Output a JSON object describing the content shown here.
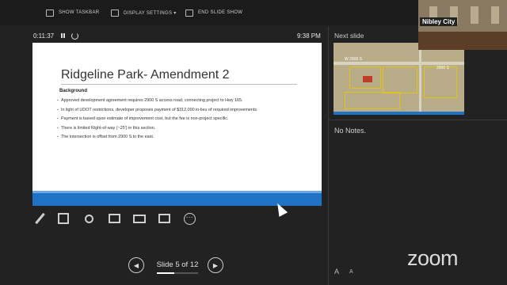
{
  "toolbar": {
    "show_taskbar": "SHOW TASKBAR",
    "display_settings": "DISPLAY SETTINGS ▾",
    "end_slide_show": "END SLIDE SHOW"
  },
  "status": {
    "timer": "0:11:37",
    "clock": "9:38 PM"
  },
  "slide": {
    "title": "Ridgeline Park- Amendment 2",
    "heading": "Background",
    "bullets": [
      "Approved development agreement requires 2900 S access road, connecting project to Hwy 165.",
      "In light of UDOT restrictions, developer proposes payment of $312,000 in-lieu of required improvements.",
      "Payment is based upon estimate of improvement cost, but the fee is non-project specific.",
      "There is limited Right-of-way (~25') in this section.",
      "The intersection is offset from 2900 S to the east."
    ]
  },
  "navigation": {
    "label": "Slide 5 of 12",
    "current": 5,
    "total": 12
  },
  "next_slide": {
    "label": "Next slide",
    "map_labels": {
      "a": "W 2900 S",
      "b": "2900 S"
    }
  },
  "notes": {
    "text": "No Notes."
  },
  "font_controls": {
    "increase": "A",
    "decrease": "A"
  },
  "video": {
    "name": "Nibley City"
  },
  "brand": {
    "logo": "zoom"
  },
  "tools": [
    "pen-icon",
    "grid-icon",
    "zoom-icon",
    "laser-icon",
    "screen-icon",
    "camera-icon",
    "more-icon"
  ],
  "colors": {
    "accent_blue": "#1f72c4",
    "parcel_yellow": "#e2c21d"
  }
}
